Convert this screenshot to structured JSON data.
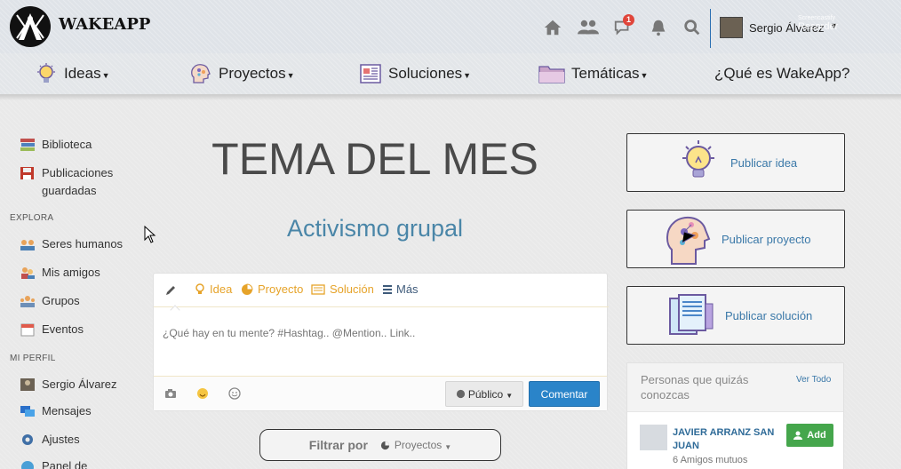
{
  "brand": {
    "name": "WAKEAPP"
  },
  "topbar": {
    "icons": [
      "home-icon",
      "groups-icon",
      "chat-icon",
      "bell-icon",
      "search-icon"
    ],
    "notification_count": "1",
    "user_name": "Sergio Álvarez",
    "watermark_small": "Screencastify",
    "watermark": "Recorder"
  },
  "nav": {
    "items": [
      {
        "label": "Ideas",
        "icon": "lightbulb-icon"
      },
      {
        "label": "Proyectos",
        "icon": "head-network-icon"
      },
      {
        "label": "Soluciones",
        "icon": "newspaper-icon"
      },
      {
        "label": "Temáticas",
        "icon": "folder-icon"
      },
      {
        "label": "¿Qué es WakeApp?"
      }
    ]
  },
  "sidebar": {
    "items_top": [
      {
        "label": "Biblioteca",
        "icon": "books-icon"
      },
      {
        "label": "Publicaciones guardadas",
        "icon": "floppy-disk-icon"
      }
    ],
    "explora_heading": "EXPLORA",
    "explora": [
      {
        "label": "Seres humanos",
        "icon": "people-icon"
      },
      {
        "label": "Mis amigos",
        "icon": "friends-icon"
      },
      {
        "label": "Grupos",
        "icon": "group-icon"
      },
      {
        "label": "Eventos",
        "icon": "calendar-icon"
      }
    ],
    "perfil_heading": "MI PERFIL",
    "perfil": [
      {
        "label": "Sergio Álvarez",
        "icon": "avatar-icon"
      },
      {
        "label": "Mensajes",
        "icon": "messages-icon"
      },
      {
        "label": "Ajustes",
        "icon": "gear-icon"
      },
      {
        "label": "Panel de",
        "icon": "panel-icon"
      }
    ]
  },
  "main": {
    "title": "TEMA DEL MES",
    "subtitle": "Activismo grupal",
    "composer": {
      "tabs": [
        {
          "label": "Idea",
          "icon": "lightbulb-icon"
        },
        {
          "label": "Proyecto",
          "icon": "pie-icon"
        },
        {
          "label": "Solución",
          "icon": "newspaper-icon"
        },
        {
          "label": "Más",
          "icon": "list-icon"
        }
      ],
      "placeholder": "¿Qué hay en tu mente? #Hashtag.. @Mention.. Link..",
      "privacy_label": "Público",
      "submit_label": "Comentar"
    },
    "filter": {
      "label": "Filtrar por",
      "option": "Proyectos"
    }
  },
  "right": {
    "publish": [
      {
        "label": "Publicar idea",
        "icon": "lightbulb-icon"
      },
      {
        "label": "Publicar proyecto",
        "icon": "head-network-icon"
      },
      {
        "label": "Publicar solución",
        "icon": "documents-icon"
      }
    ],
    "people": {
      "title": "Personas que quizás conozcas",
      "see_all": "Ver Todo",
      "person_name": "JAVIER ARRANZ SAN JUAN",
      "person_mutual": "6 Amigos mutuos",
      "add_label": "Add"
    }
  },
  "colors": {
    "accent_blue": "#2a84c9",
    "gold": "#e6a329",
    "green": "#45a64c",
    "link": "#3a78a8"
  }
}
